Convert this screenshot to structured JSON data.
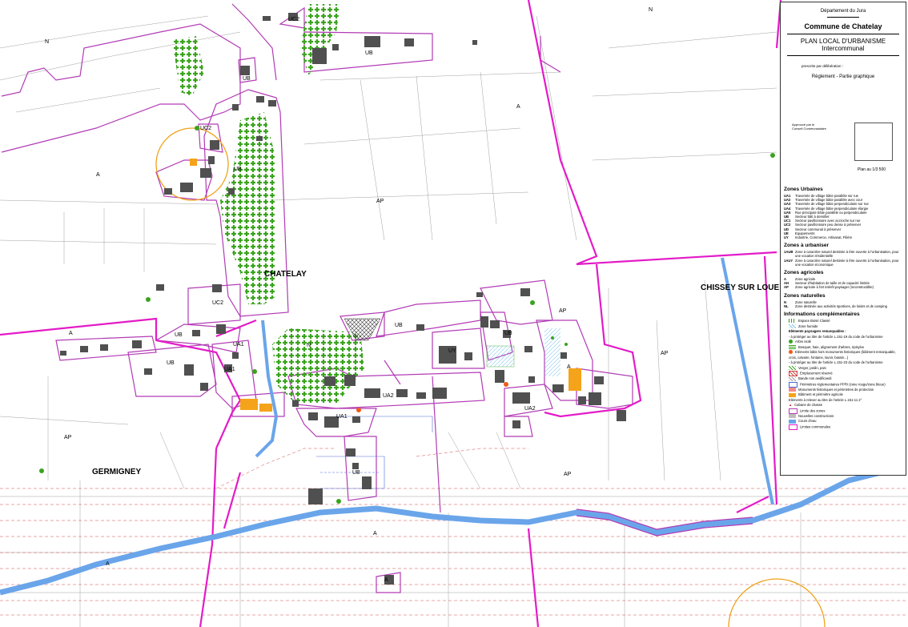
{
  "colors": {
    "zone_limit": "#b23bb5",
    "commune_limit": "#e31bc8",
    "river": "#6aa5ea",
    "protection": "#f0a21c",
    "flood": "#d24a4a",
    "building": "#505050",
    "farm_building": "#f5a31a",
    "trees": "#3aa31e"
  },
  "places": {
    "chatelay": "CHATELAY",
    "chissey": "CHISSEY SUR LOUE",
    "germigney": "GERMIGNEY"
  },
  "zone_labels": {
    "n_tl": "N",
    "n_top": "N",
    "uc2_top": "UC2",
    "ub_top": "UB",
    "ub_small": "UB",
    "a_right": "A",
    "uc2_mid": "UC2",
    "ub_mid": "UB",
    "a_left": "A",
    "ap_mid": "AP",
    "uc2_low": "UC2",
    "a_row": "A",
    "ub_row": "UB",
    "ua1_a": "UA1",
    "ub_vil": "UB",
    "ua1_b": "UA1",
    "n_vil": "N",
    "ub_east": "UB",
    "uy": "UY",
    "ub_e2": "UB",
    "ap_e": "AP",
    "a_e": "A",
    "ap_far": "AP",
    "ua2_a": "UA2",
    "ua1_c": "UA1",
    "ua2_b": "UA2",
    "ub_south": "UB",
    "ap_left": "AP",
    "ap_south": "AP",
    "a_south": "A",
    "a_sw": "A",
    "a_bottom": "A"
  },
  "legend": {
    "department": "Département du Jura",
    "commune": "Commune de Chatelay",
    "plu_line1": "PLAN LOCAL D'URBANISME",
    "plu_line2": "Intercommunal",
    "prescribed": "prescrite par délibération :",
    "reglement": "Règlement - Partie graphique",
    "approved_line1": "Approuvé par le",
    "approved_line2": "Conseil Communautaire",
    "scale": "Plan au 1/3 500",
    "sections": {
      "urbaines": "Zones Urbaines",
      "a_urbaniser": "Zones à urbaniser",
      "agricoles": "Zones agricoles",
      "naturelles": "Zones naturelles",
      "complementaires": "Informations complémentaires"
    },
    "urban_zones": [
      {
        "code": "UA1",
        "text": "Traversée de village bâtie parallèle sur rue"
      },
      {
        "code": "UA2",
        "text": "Traversée de village bâtie parallèle avec cour"
      },
      {
        "code": "UA3",
        "text": "Traversée de village bâtie perpendiculaire sur rue"
      },
      {
        "code": "UA4",
        "text": "Traversée de village bâtie perpendiculaire élargie"
      },
      {
        "code": "UA5",
        "text": "Rue principale bâtie parallèle ou perpendiculaire"
      },
      {
        "code": "UB",
        "text": "Secteur bâti à densifier"
      },
      {
        "code": "UC1",
        "text": "Secteur pavillonnaire avec accroche sur rue"
      },
      {
        "code": "UC2",
        "text": "Secteur pavillonnaire peu dense à préserver"
      },
      {
        "code": "UD",
        "text": "Secteur communal à préserver"
      },
      {
        "code": "UE",
        "text": "Equipements"
      },
      {
        "code": "UY",
        "text": "Industrie, Commerce, Artisanat, Filière"
      }
    ],
    "au_zones": [
      {
        "code": "1AUB",
        "text": "Zone à caractère naturel destinée à être ouverte à l'urbanisation, pour une vocation résidentielle"
      },
      {
        "code": "1AUY",
        "text": "Zone à caractère naturel destinée à être ouverte à l'urbanisation, pour une vocation économique"
      }
    ],
    "agri_zones": [
      {
        "code": "A",
        "text": "Zone agricole"
      },
      {
        "code": "AH",
        "text": "Secteur d'habitation de taille et de capacité limitée"
      },
      {
        "code": "AP",
        "text": "Zone agricole à fort intérêt paysager (inconstructible)"
      }
    ],
    "nat_zones": [
      {
        "code": "N",
        "text": "Zone naturelle"
      },
      {
        "code": "NL",
        "text": "Zone destinée aux activités sportives, de loisirs et de camping"
      }
    ],
    "info_items": {
      "ebc": "Espace Boisé Classé",
      "humide": "Zone humide",
      "paysagers_title": "Eléments paysagers remarquables :",
      "paysagers_sub": "- à protéger au titre de l'article L.151-19 du code de l'urbanisme",
      "arbre": "Arbre isolé",
      "bosquet": "Bosquet, haie, alignement d'arbres, ripisylve",
      "monuments": "Eléments bâtis hors monuments historiques (bâtiment remarquable, croix, calvaire, fontaine, lavoir, bassin...)",
      "paysagers_sub2": "- à protéger au titre de l'article L.151-23 du code de l'urbanisme",
      "verger": "Verger, jardin, parc",
      "emplacement": "Emplacement réservé",
      "bande": "Bande non aedificandi",
      "ppri": "Périmètres réglementaires PPRI (zone rouge/zone bleue)",
      "mh": "Monuments historiques et périmètres de protection",
      "agricole": "Bâtiment et périmètre agricole",
      "changement": "Eléments à relever au titre de l'article L.151-11 2°",
      "cabane": "Cabane de chasse",
      "limite_zones": "Limite des zones",
      "nouvelles": "Nouvelles constructions",
      "cours": "Cours d'eau",
      "communales": "Limites communales"
    }
  }
}
